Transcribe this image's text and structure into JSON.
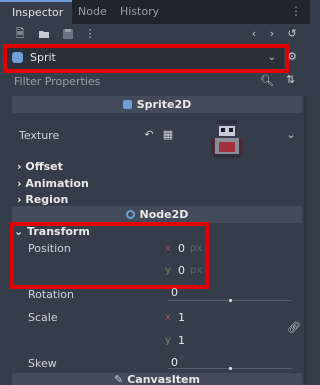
{
  "tabs": [
    {
      "label": "Inspector",
      "active": true
    },
    {
      "label": "Node",
      "active": false
    },
    {
      "label": "History",
      "active": false
    }
  ],
  "toolbar": {
    "icons": [
      "new-resource-icon",
      "open-folder-icon",
      "save-icon",
      "more-icon",
      "back-icon",
      "forward-icon",
      "history-icon"
    ]
  },
  "object_selector": {
    "label": "Sprit"
  },
  "filter": {
    "placeholder": "Filter Properties"
  },
  "sections": {
    "sprite2d": "Sprite2D",
    "node2d": "Node2D",
    "canvas_item": "CanvasItem"
  },
  "properties": {
    "texture": "Texture",
    "offset": "Offset",
    "animation": "Animation",
    "region": "Region",
    "transform": "Transform",
    "position": "Position",
    "position_x_axis": "x",
    "position_x_value": "0",
    "position_x_unit": "px",
    "position_y_axis": "y",
    "position_y_value": "0",
    "position_y_unit": "px",
    "rotation": "Rotation",
    "rotation_value": "0",
    "rotation_level": 0.5,
    "scale": "Scale",
    "scale_x_axis": "x",
    "scale_x_value": "1",
    "scale_y_axis": "y",
    "scale_y_value": "1",
    "skew": "Skew",
    "skew_value": "0",
    "skew_unit": "°",
    "skew_level": 0.5
  },
  "colors": {
    "accent": "#6e9fd8",
    "highlight_box": "#e00000",
    "axis_x": "#e06c75",
    "axis_y": "#98c379"
  }
}
